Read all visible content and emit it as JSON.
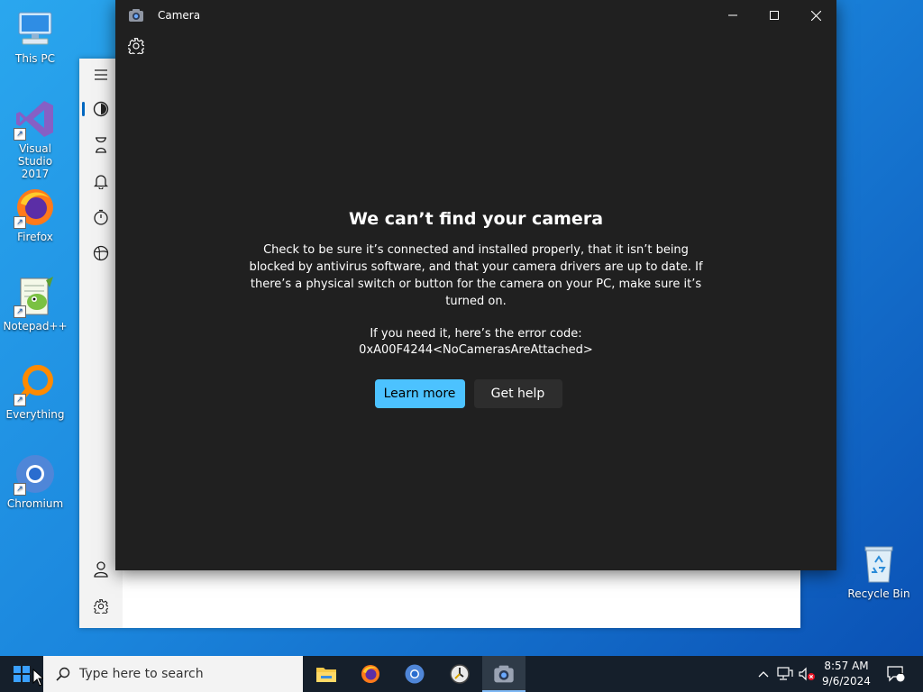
{
  "desktop": {
    "icons": [
      {
        "label": "This PC"
      },
      {
        "label": "Visual Studio 2017"
      },
      {
        "label": "Firefox"
      },
      {
        "label": "Notepad++"
      },
      {
        "label": "Everything"
      },
      {
        "label": "Chromium"
      },
      {
        "label": "Recycle Bin"
      }
    ]
  },
  "camera_window": {
    "title": "Camera",
    "heading": "We can’t find your camera",
    "body": "Check to be sure it’s connected and installed properly, that it isn’t being blocked by antivirus software, and that your camera drivers are up to date. If there’s a physical switch or button for the camera on your PC, make sure it’s turned on.",
    "error_intro": "If you need it, here’s the error code:",
    "error_code": "0xA00F4244<NoCamerasAreAttached>",
    "primary_button": "Learn more",
    "secondary_button": "Get help"
  },
  "taskbar": {
    "search_placeholder": "Type here to search",
    "time": "8:57 AM",
    "date": "9/6/2024",
    "notification_count": "1"
  },
  "colors": {
    "accent": "#4cc2ff",
    "camera_bg": "#202020",
    "taskbar_bg": "#151f2b"
  }
}
